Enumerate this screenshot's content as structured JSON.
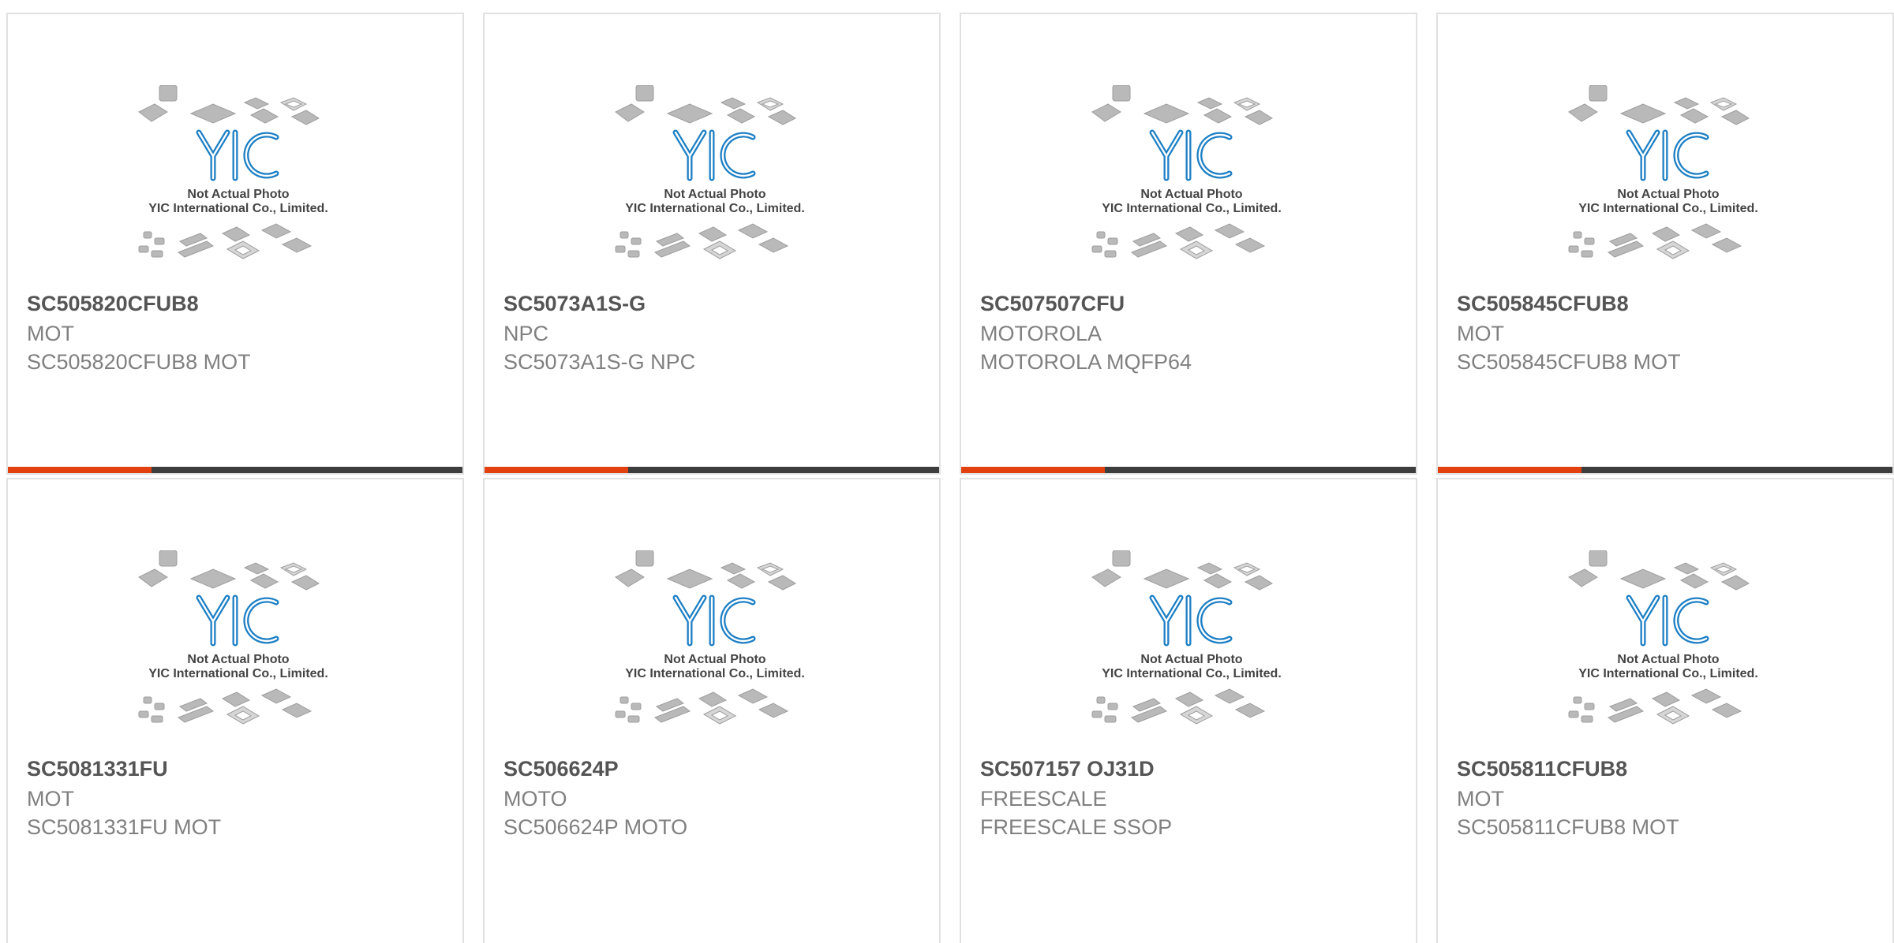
{
  "accent_color": "#e2400f",
  "bar_color": "#3d3d3d",
  "thumbnail": {
    "logo_text": "YIC",
    "line1": "Not Actual Photo",
    "line2": "YIC International Co., Limited.",
    "icon": "chip-packages-placeholder-icon"
  },
  "products": [
    {
      "part": "SC505820CFUB8",
      "brand": "MOT",
      "desc": "SC505820CFUB8 MOT"
    },
    {
      "part": "SC5073A1S-G",
      "brand": "NPC",
      "desc": "SC5073A1S-G NPC"
    },
    {
      "part": "SC507507CFU",
      "brand": "MOTOROLA",
      "desc": "MOTOROLA MQFP64"
    },
    {
      "part": "SC505845CFUB8",
      "brand": "MOT",
      "desc": "SC505845CFUB8 MOT"
    },
    {
      "part": "SC5081331FU",
      "brand": "MOT",
      "desc": "SC5081331FU MOT"
    },
    {
      "part": "SC506624P",
      "brand": "MOTO",
      "desc": "SC506624P MOTO"
    },
    {
      "part": "SC507157 OJ31D",
      "brand": "FREESCALE",
      "desc": "FREESCALE SSOP"
    },
    {
      "part": "SC505811CFUB8",
      "brand": "MOT",
      "desc": "SC505811CFUB8 MOT"
    }
  ]
}
